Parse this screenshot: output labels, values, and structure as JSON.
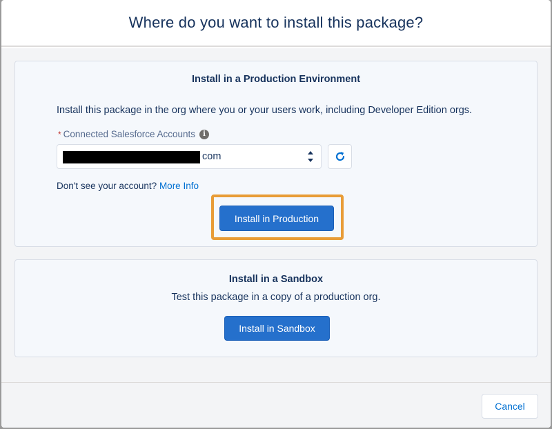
{
  "modal": {
    "title": "Where do you want to install this package?"
  },
  "production": {
    "title": "Install in a Production Environment",
    "description": "Install this package in the org where you or your users work, including Developer Edition orgs.",
    "field_required_marker": "*",
    "field_label": "Connected Salesforce Accounts",
    "info_icon_glyph": "i",
    "selected_account_suffix": "com",
    "help_text": "Don't see your account?",
    "help_link": "More Info",
    "install_button": "Install in Production",
    "highlight_color": "#e89c37"
  },
  "sandbox": {
    "title": "Install in a Sandbox",
    "description": "Test this package in a copy of a production org.",
    "install_button": "Install in Sandbox"
  },
  "footer": {
    "cancel_button": "Cancel"
  },
  "colors": {
    "brand": "#2570cc",
    "link": "#0070d2",
    "text": "#16325c"
  },
  "icons": {
    "refresh": "refresh-icon",
    "info": "info-icon",
    "select_arrows": "select-arrows-icon"
  }
}
